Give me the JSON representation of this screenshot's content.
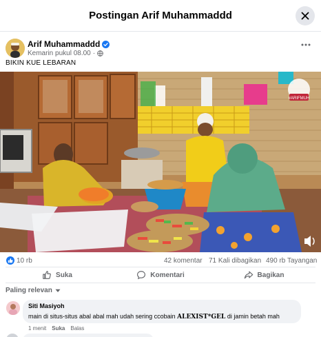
{
  "header": {
    "title": "Postingan Arif Muhammaddd"
  },
  "post": {
    "author": "Arif Muhammaddd",
    "time": "Kemarin pukul 08.00",
    "caption": "BIKIN KUE LEBARAN",
    "image_watermark": "#ARIFMUH"
  },
  "stats": {
    "reactions": "10 rb",
    "comments": "42 komentar",
    "shares": "71 Kali dibagikan",
    "views": "490 rb Tayangan"
  },
  "actions": {
    "like": "Suka",
    "comment": "Komentari",
    "share": "Bagikan"
  },
  "sort": {
    "label": "Paling relevan"
  },
  "comment": {
    "author": "Siti Masiyoh",
    "text_before": "main di situs-situs abal abal mah udah sering ccobain",
    "brand": "ALEXIST*GEL",
    "text_after": "di jamin betah mah",
    "time": "1 menit",
    "like": "Suka",
    "reply": "Balas"
  },
  "colors": {
    "accent": "#1877f2",
    "muted": "#65676b",
    "bubble": "#f0f2f5"
  }
}
